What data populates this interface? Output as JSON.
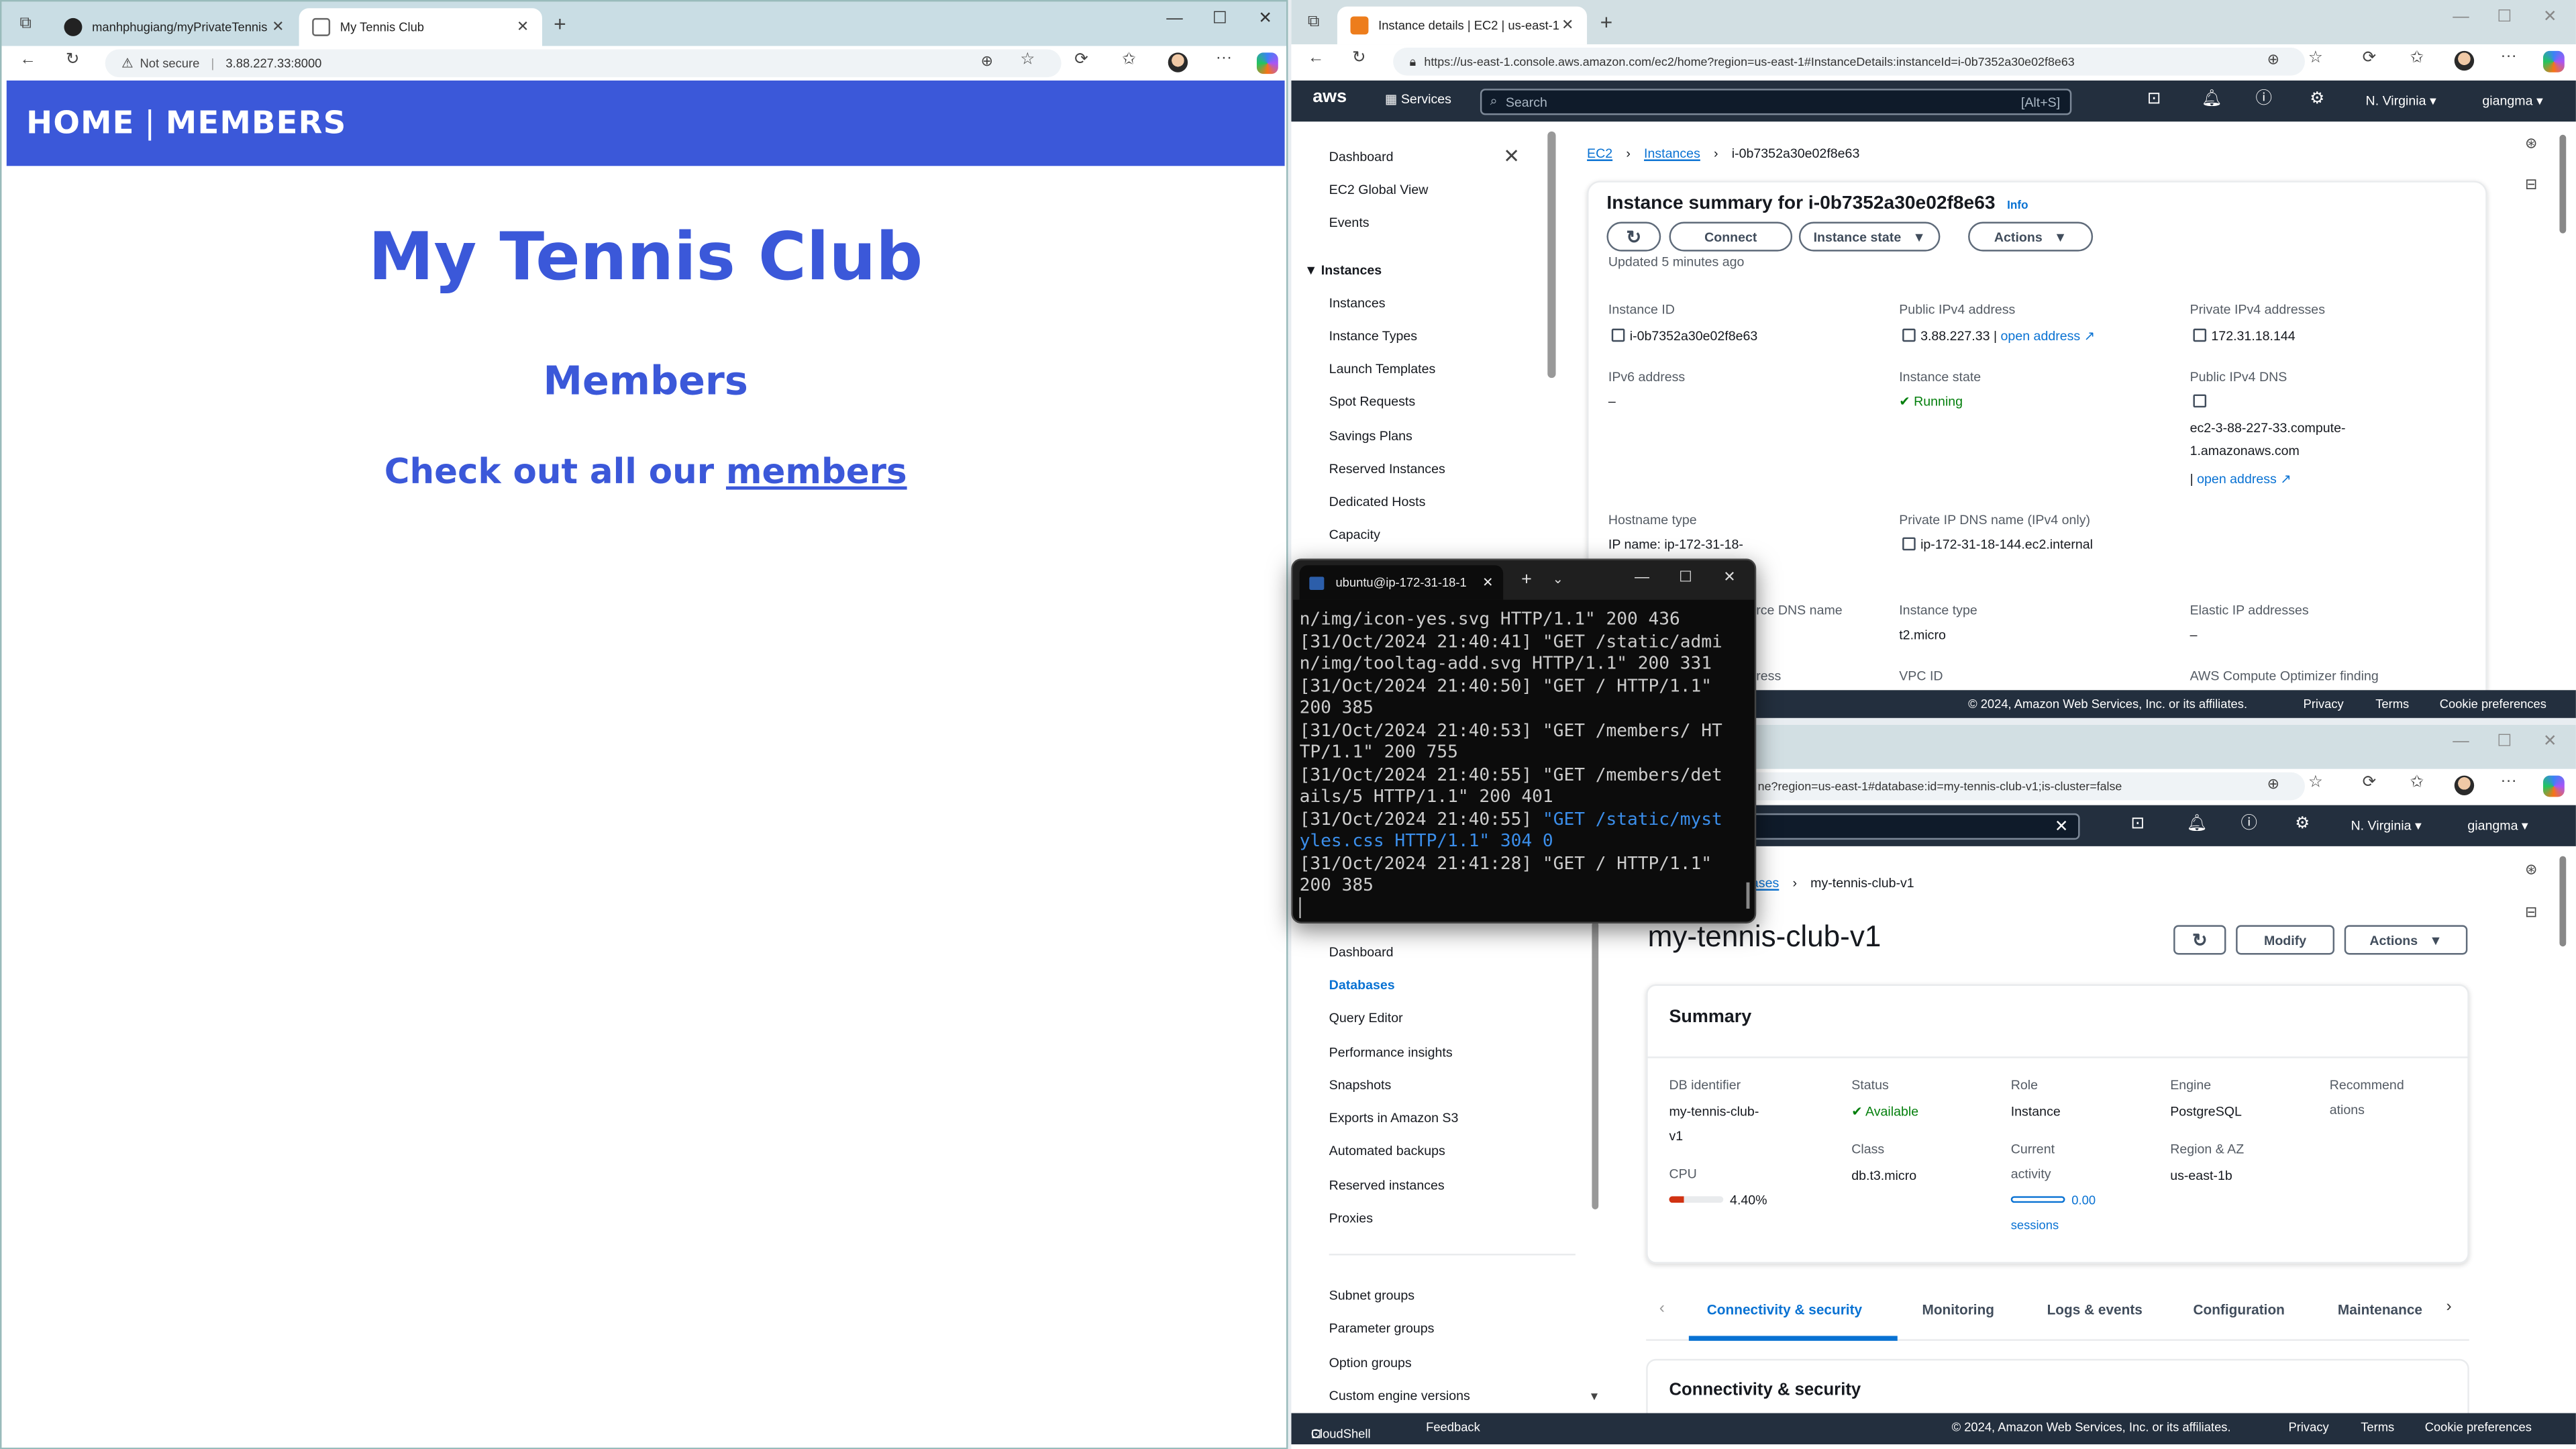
{
  "left_browser": {
    "tabs": [
      {
        "label": "manhphugiang/myPrivateTennis",
        "active": false
      },
      {
        "label": "My Tennis Club",
        "active": true
      }
    ],
    "security": "Not secure",
    "url": "3.88.227.33:8000",
    "page": {
      "nav_home": "HOME",
      "nav_sep": "|",
      "nav_members": "MEMBERS",
      "title": "My Tennis Club",
      "subtitle": "Members",
      "cta_prefix": "Check out all our ",
      "cta_link": "members"
    }
  },
  "ec2_browser": {
    "tab_label": "Instance details | EC2 | us-east-1",
    "url": "https://us-east-1.console.aws.amazon.com/ec2/home?region=us-east-1#InstanceDetails:instanceId=i-0b7352a30e02f8e63",
    "nav": {
      "services": "Services",
      "search": "Search",
      "shortcut": "[Alt+S]",
      "region": "N. Virginia",
      "user": "giangma"
    },
    "sidebar": [
      "Dashboard",
      "EC2 Global View",
      "Events",
      "Instances",
      "Instances",
      "Instance Types",
      "Launch Templates",
      "Spot Requests",
      "Savings Plans",
      "Reserved Instances",
      "Dedicated Hosts",
      "Capacity"
    ],
    "breadcrumb": [
      "EC2",
      "Instances",
      "i-0b7352a30e02f8e63"
    ],
    "summary_title": "Instance summary for i-0b7352a30e02f8e63",
    "info": "Info",
    "buttons": {
      "connect": "Connect",
      "state": "Instance state",
      "actions": "Actions"
    },
    "updated": "Updated 5 minutes ago",
    "fields": {
      "instance_id_label": "Instance ID",
      "instance_id": "i-0b7352a30e02f8e63",
      "public_ipv4_label": "Public IPv4 address",
      "public_ipv4": "3.88.227.33",
      "open_address": "open address",
      "private_ipv4_label": "Private IPv4 addresses",
      "private_ipv4": "172.31.18.144",
      "ipv6_label": "IPv6 address",
      "ipv6": "–",
      "state_label": "Instance state",
      "state": "Running",
      "public_dns_label": "Public IPv4 DNS",
      "public_dns_1": "ec2-3-88-227-33.compute-",
      "public_dns_2": "1.amazonaws.com",
      "hostname_label": "Hostname type",
      "hostname": "IP name: ip-172-31-18-",
      "private_dns_label": "Private IP DNS name (IPv4 only)",
      "private_dns": "ip-172-31-18-144.ec2.internal",
      "resource_dns_label": "rce DNS name",
      "type_label": "Instance type",
      "type": "t2.micro",
      "eip_label": "Elastic IP addresses",
      "eip": "–",
      "ress_label": "ress",
      "vpc_label": "VPC ID",
      "optimizer_label": "AWS Compute Optimizer finding"
    },
    "footer": {
      "copy": "© 2024, Amazon Web Services, Inc. or its affiliates.",
      "privacy": "Privacy",
      "terms": "Terms",
      "cookies": "Cookie preferences"
    }
  },
  "rds_browser": {
    "url": "ne?region=us-east-1#database:id=my-tennis-club-v1;is-cluster=false",
    "nav": {
      "region": "N. Virginia",
      "user": "giangma"
    },
    "breadcrumb": [
      "ases",
      "my-tennis-club-v1"
    ],
    "title": "my-tennis-club-v1",
    "buttons": {
      "modify": "Modify",
      "actions": "Actions"
    },
    "sidebar": [
      "Dashboard",
      "Databases",
      "Query Editor",
      "Performance insights",
      "Snapshots",
      "Exports in Amazon S3",
      "Automated backups",
      "Reserved instances",
      "Proxies",
      "Subnet groups",
      "Parameter groups",
      "Option groups",
      "Custom engine versions"
    ],
    "summary": "Summary",
    "fields": {
      "dbid_label": "DB identifier",
      "dbid_1": "my-tennis-club-",
      "dbid_2": "v1",
      "cpu_label": "CPU",
      "cpu": "4.40%",
      "cpu_fraction": 0.044,
      "status_label": "Status",
      "status": "Available",
      "class_label": "Class",
      "class": "db.t3.micro",
      "role_label": "Role",
      "role": "Instance",
      "activity_label_1": "Current",
      "activity_label_2": "activity",
      "activity": "0.00",
      "activity_unit": "sessions",
      "engine_label": "Engine",
      "engine": "PostgreSQL",
      "region_label": "Region & AZ",
      "region": "us-east-1b",
      "recommend_1": "Recommend",
      "recommend_2": "ations"
    },
    "tabs": [
      "Connectivity & security",
      "Monitoring",
      "Logs & events",
      "Configuration",
      "Maintenance"
    ],
    "section": "Connectivity & security",
    "footer": {
      "cloudshell": "CloudShell",
      "feedback": "Feedback",
      "copy": "© 2024, Amazon Web Services, Inc. or its affiliates.",
      "privacy": "Privacy",
      "terms": "Terms",
      "cookies": "Cookie preferences"
    }
  },
  "terminal": {
    "tab": "ubuntu@ip-172-31-18-1",
    "lines": [
      "n/img/icon-yes.svg HTTP/1.1\" 200 436",
      "[31/Oct/2024 21:40:41] \"GET /static/admi",
      "n/img/tooltag-add.svg HTTP/1.1\" 200 331",
      "[31/Oct/2024 21:40:50] \"GET / HTTP/1.1\"",
      "200 385",
      "[31/Oct/2024 21:40:53] \"GET /members/ HT",
      "TP/1.1\" 200 755",
      "[31/Oct/2024 21:40:55] \"GET /members/det",
      "ails/5 HTTP/1.1\" 200 401",
      "[31/Oct/2024 21:40:55] ",
      "yles.css HTTP/1.1\" 304 0",
      "[31/Oct/2024 21:41:28] \"GET / HTTP/1.1\"",
      "200 385"
    ],
    "blue_part": "\"GET /static/myst"
  }
}
